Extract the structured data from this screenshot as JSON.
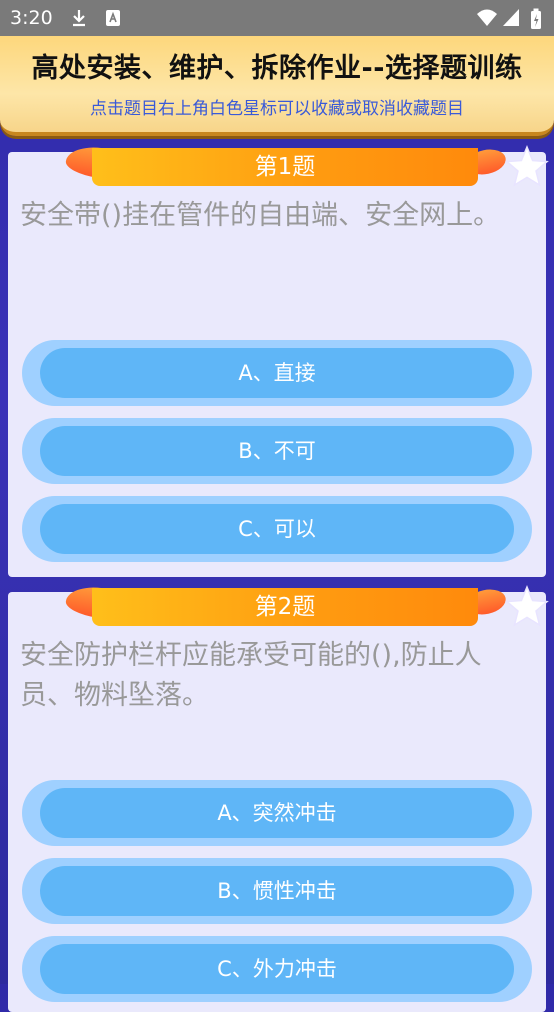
{
  "status_bar": {
    "time": "3:20",
    "icons": [
      "download-icon",
      "app-icon",
      "wifi-icon",
      "signal-icon",
      "battery-icon"
    ]
  },
  "header": {
    "title": "高处安装、维护、拆除作业--选择题训练",
    "subtitle": "点击题目右上角白色星标可以收藏或取消收藏题目"
  },
  "questions": [
    {
      "badge": "第1题",
      "text": "安全带()挂在管件的自由端、安全网上。",
      "options": [
        "A、直接",
        "B、不可",
        "C、可以"
      ]
    },
    {
      "badge": "第2题",
      "text": "安全防护栏杆应能承受可能的(),防止人员、物料坠落。",
      "options": [
        "A、突然冲击",
        "B、惯性冲击",
        "C、外力冲击"
      ]
    }
  ],
  "colors": {
    "badge": "#ff9a10",
    "option": "#5fb6f7",
    "card": "#eae9fc",
    "header": "#fde6a8"
  }
}
